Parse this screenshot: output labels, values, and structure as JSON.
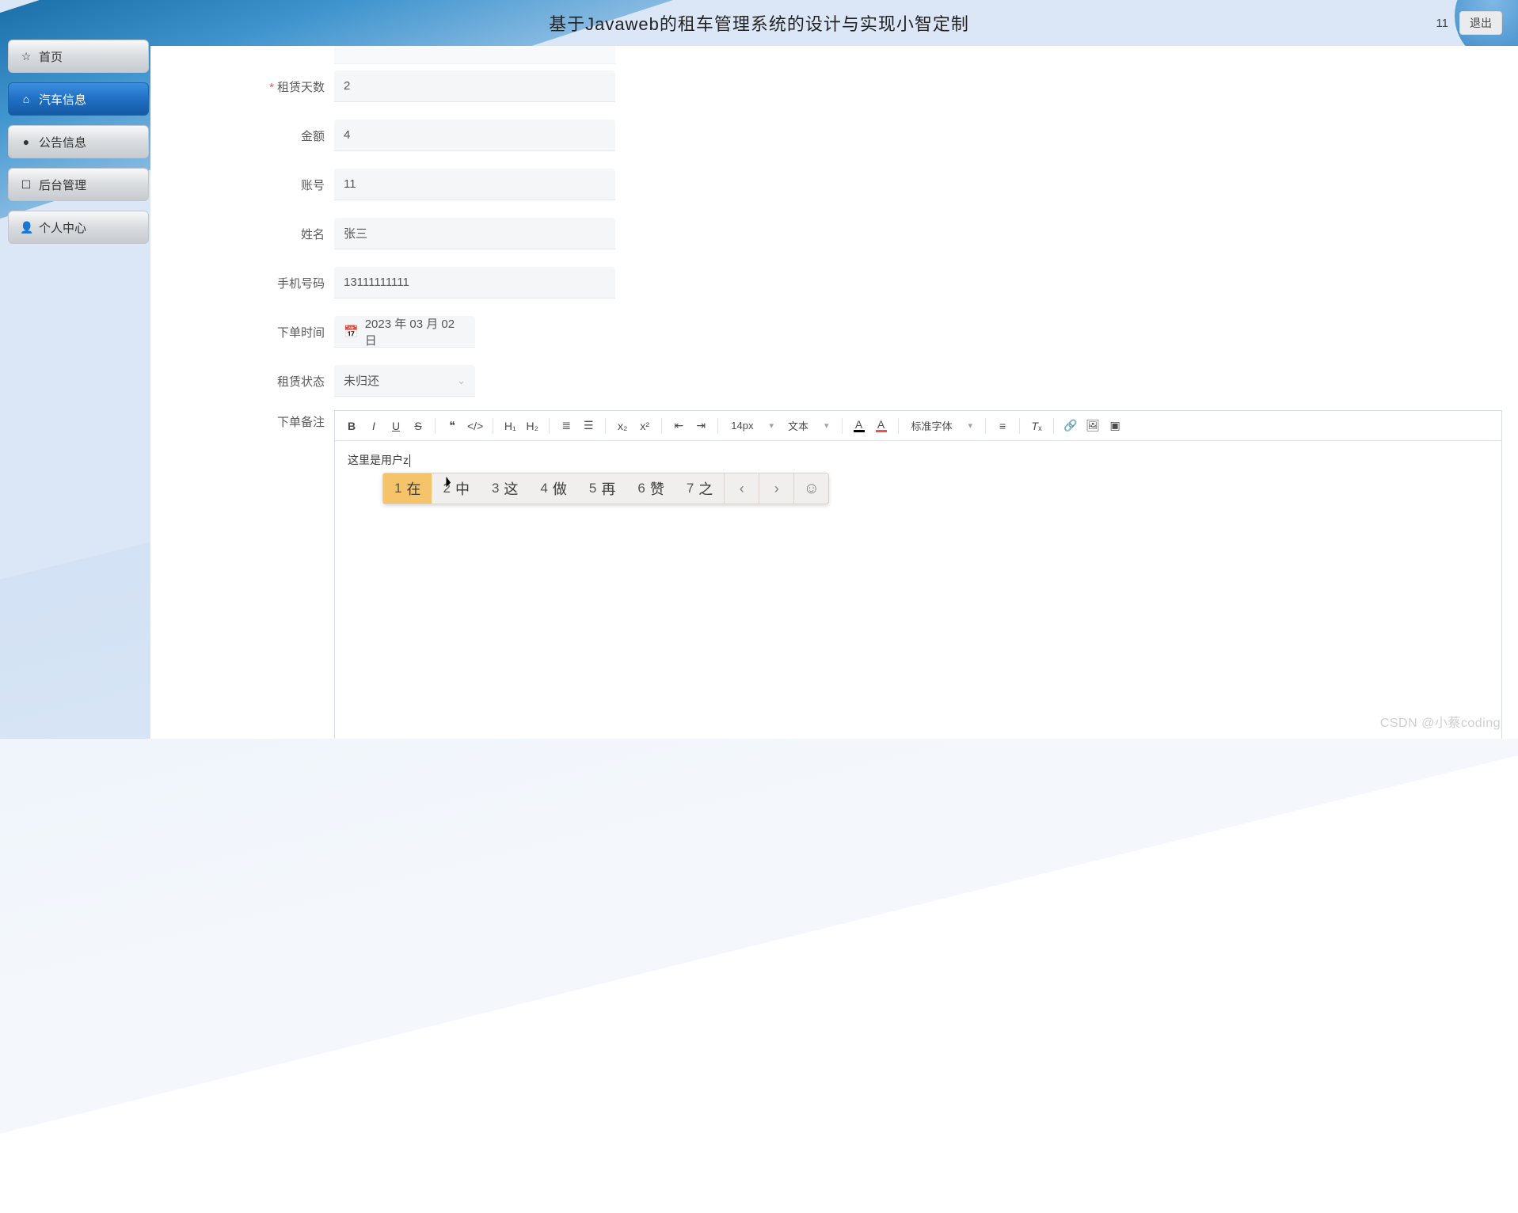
{
  "header": {
    "title": "基于Javaweb的租车管理系统的设计与实现小智定制",
    "user_name": "11",
    "logout_label": "退出"
  },
  "sidebar": {
    "items": [
      {
        "icon": "☆",
        "label": "首页",
        "active": false,
        "key": "home"
      },
      {
        "icon": "⌂",
        "label": "汽车信息",
        "active": true,
        "key": "car-info"
      },
      {
        "icon": "●",
        "label": "公告信息",
        "active": false,
        "key": "notice"
      },
      {
        "icon": "☐",
        "label": "后台管理",
        "active": false,
        "key": "admin"
      },
      {
        "icon": "👤",
        "label": "个人中心",
        "active": false,
        "key": "profile"
      }
    ]
  },
  "form": {
    "rental_days": {
      "label": "租赁天数",
      "value": "2",
      "required": true
    },
    "amount": {
      "label": "金额",
      "value": "4"
    },
    "account": {
      "label": "账号",
      "value": "11"
    },
    "name": {
      "label": "姓名",
      "value": "张三"
    },
    "phone": {
      "label": "手机号码",
      "value": "13111111111"
    },
    "order_time": {
      "label": "下单时间",
      "value": "2023 年 03 月 02 日"
    },
    "rental_status": {
      "label": "租赁状态",
      "value": "未归还"
    },
    "remark": {
      "label": "下单备注"
    }
  },
  "editor": {
    "toolbar": {
      "h1": "H₁",
      "h2": "H₂",
      "font_size": "14px",
      "font_kind": "文本",
      "font_family": "标准字体"
    },
    "content": "这里是用户z",
    "ime": {
      "candidates": [
        {
          "num": "1",
          "word": "在",
          "selected": true
        },
        {
          "num": "2",
          "word": "中"
        },
        {
          "num": "3",
          "word": "这"
        },
        {
          "num": "4",
          "word": "做"
        },
        {
          "num": "5",
          "word": "再"
        },
        {
          "num": "6",
          "word": "赞"
        },
        {
          "num": "7",
          "word": "之"
        }
      ]
    }
  },
  "watermark": "CSDN @小蔡coding"
}
